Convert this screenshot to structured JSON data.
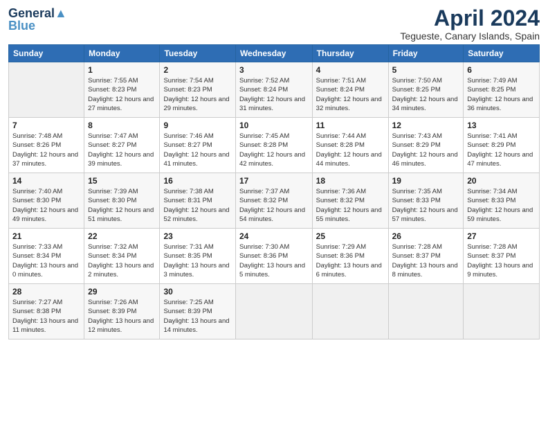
{
  "header": {
    "logo_line1": "General",
    "logo_line2": "Blue",
    "title": "April 2024",
    "subtitle": "Tegueste, Canary Islands, Spain"
  },
  "days_of_week": [
    "Sunday",
    "Monday",
    "Tuesday",
    "Wednesday",
    "Thursday",
    "Friday",
    "Saturday"
  ],
  "weeks": [
    [
      {
        "day": "",
        "sunrise": "",
        "sunset": "",
        "daylight": ""
      },
      {
        "day": "1",
        "sunrise": "Sunrise: 7:55 AM",
        "sunset": "Sunset: 8:23 PM",
        "daylight": "Daylight: 12 hours and 27 minutes."
      },
      {
        "day": "2",
        "sunrise": "Sunrise: 7:54 AM",
        "sunset": "Sunset: 8:23 PM",
        "daylight": "Daylight: 12 hours and 29 minutes."
      },
      {
        "day": "3",
        "sunrise": "Sunrise: 7:52 AM",
        "sunset": "Sunset: 8:24 PM",
        "daylight": "Daylight: 12 hours and 31 minutes."
      },
      {
        "day": "4",
        "sunrise": "Sunrise: 7:51 AM",
        "sunset": "Sunset: 8:24 PM",
        "daylight": "Daylight: 12 hours and 32 minutes."
      },
      {
        "day": "5",
        "sunrise": "Sunrise: 7:50 AM",
        "sunset": "Sunset: 8:25 PM",
        "daylight": "Daylight: 12 hours and 34 minutes."
      },
      {
        "day": "6",
        "sunrise": "Sunrise: 7:49 AM",
        "sunset": "Sunset: 8:25 PM",
        "daylight": "Daylight: 12 hours and 36 minutes."
      }
    ],
    [
      {
        "day": "7",
        "sunrise": "Sunrise: 7:48 AM",
        "sunset": "Sunset: 8:26 PM",
        "daylight": "Daylight: 12 hours and 37 minutes."
      },
      {
        "day": "8",
        "sunrise": "Sunrise: 7:47 AM",
        "sunset": "Sunset: 8:27 PM",
        "daylight": "Daylight: 12 hours and 39 minutes."
      },
      {
        "day": "9",
        "sunrise": "Sunrise: 7:46 AM",
        "sunset": "Sunset: 8:27 PM",
        "daylight": "Daylight: 12 hours and 41 minutes."
      },
      {
        "day": "10",
        "sunrise": "Sunrise: 7:45 AM",
        "sunset": "Sunset: 8:28 PM",
        "daylight": "Daylight: 12 hours and 42 minutes."
      },
      {
        "day": "11",
        "sunrise": "Sunrise: 7:44 AM",
        "sunset": "Sunset: 8:28 PM",
        "daylight": "Daylight: 12 hours and 44 minutes."
      },
      {
        "day": "12",
        "sunrise": "Sunrise: 7:43 AM",
        "sunset": "Sunset: 8:29 PM",
        "daylight": "Daylight: 12 hours and 46 minutes."
      },
      {
        "day": "13",
        "sunrise": "Sunrise: 7:41 AM",
        "sunset": "Sunset: 8:29 PM",
        "daylight": "Daylight: 12 hours and 47 minutes."
      }
    ],
    [
      {
        "day": "14",
        "sunrise": "Sunrise: 7:40 AM",
        "sunset": "Sunset: 8:30 PM",
        "daylight": "Daylight: 12 hours and 49 minutes."
      },
      {
        "day": "15",
        "sunrise": "Sunrise: 7:39 AM",
        "sunset": "Sunset: 8:30 PM",
        "daylight": "Daylight: 12 hours and 51 minutes."
      },
      {
        "day": "16",
        "sunrise": "Sunrise: 7:38 AM",
        "sunset": "Sunset: 8:31 PM",
        "daylight": "Daylight: 12 hours and 52 minutes."
      },
      {
        "day": "17",
        "sunrise": "Sunrise: 7:37 AM",
        "sunset": "Sunset: 8:32 PM",
        "daylight": "Daylight: 12 hours and 54 minutes."
      },
      {
        "day": "18",
        "sunrise": "Sunrise: 7:36 AM",
        "sunset": "Sunset: 8:32 PM",
        "daylight": "Daylight: 12 hours and 55 minutes."
      },
      {
        "day": "19",
        "sunrise": "Sunrise: 7:35 AM",
        "sunset": "Sunset: 8:33 PM",
        "daylight": "Daylight: 12 hours and 57 minutes."
      },
      {
        "day": "20",
        "sunrise": "Sunrise: 7:34 AM",
        "sunset": "Sunset: 8:33 PM",
        "daylight": "Daylight: 12 hours and 59 minutes."
      }
    ],
    [
      {
        "day": "21",
        "sunrise": "Sunrise: 7:33 AM",
        "sunset": "Sunset: 8:34 PM",
        "daylight": "Daylight: 13 hours and 0 minutes."
      },
      {
        "day": "22",
        "sunrise": "Sunrise: 7:32 AM",
        "sunset": "Sunset: 8:34 PM",
        "daylight": "Daylight: 13 hours and 2 minutes."
      },
      {
        "day": "23",
        "sunrise": "Sunrise: 7:31 AM",
        "sunset": "Sunset: 8:35 PM",
        "daylight": "Daylight: 13 hours and 3 minutes."
      },
      {
        "day": "24",
        "sunrise": "Sunrise: 7:30 AM",
        "sunset": "Sunset: 8:36 PM",
        "daylight": "Daylight: 13 hours and 5 minutes."
      },
      {
        "day": "25",
        "sunrise": "Sunrise: 7:29 AM",
        "sunset": "Sunset: 8:36 PM",
        "daylight": "Daylight: 13 hours and 6 minutes."
      },
      {
        "day": "26",
        "sunrise": "Sunrise: 7:28 AM",
        "sunset": "Sunset: 8:37 PM",
        "daylight": "Daylight: 13 hours and 8 minutes."
      },
      {
        "day": "27",
        "sunrise": "Sunrise: 7:28 AM",
        "sunset": "Sunset: 8:37 PM",
        "daylight": "Daylight: 13 hours and 9 minutes."
      }
    ],
    [
      {
        "day": "28",
        "sunrise": "Sunrise: 7:27 AM",
        "sunset": "Sunset: 8:38 PM",
        "daylight": "Daylight: 13 hours and 11 minutes."
      },
      {
        "day": "29",
        "sunrise": "Sunrise: 7:26 AM",
        "sunset": "Sunset: 8:39 PM",
        "daylight": "Daylight: 13 hours and 12 minutes."
      },
      {
        "day": "30",
        "sunrise": "Sunrise: 7:25 AM",
        "sunset": "Sunset: 8:39 PM",
        "daylight": "Daylight: 13 hours and 14 minutes."
      },
      {
        "day": "",
        "sunrise": "",
        "sunset": "",
        "daylight": ""
      },
      {
        "day": "",
        "sunrise": "",
        "sunset": "",
        "daylight": ""
      },
      {
        "day": "",
        "sunrise": "",
        "sunset": "",
        "daylight": ""
      },
      {
        "day": "",
        "sunrise": "",
        "sunset": "",
        "daylight": ""
      }
    ]
  ]
}
